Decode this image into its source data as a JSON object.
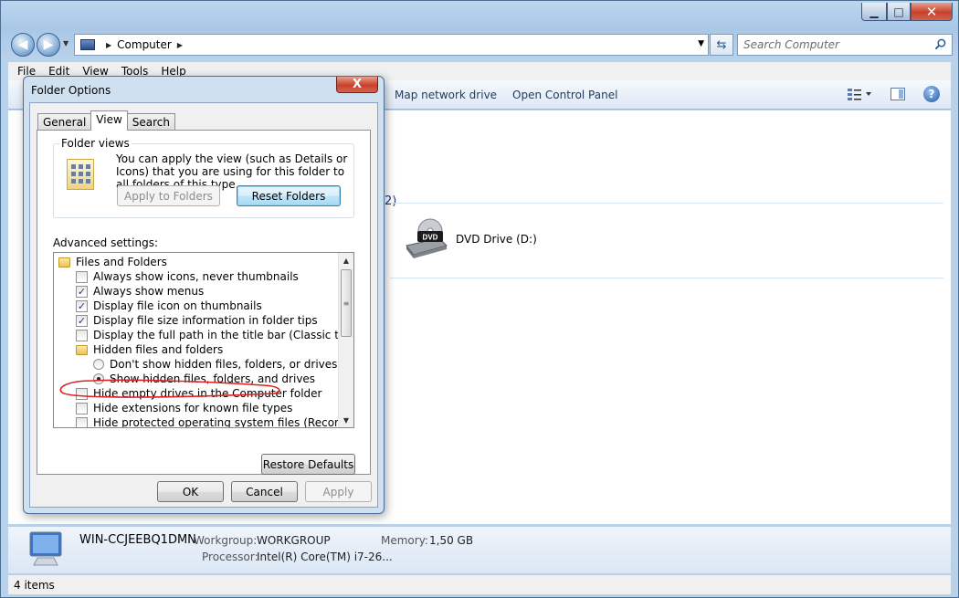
{
  "explorer": {
    "address": {
      "location": "Computer"
    },
    "search": {
      "placeholder": "Search Computer"
    },
    "menu": [
      "File",
      "Edit",
      "View",
      "Tools",
      "Help"
    ],
    "toolbar": {
      "map_network": "Map network drive",
      "control_panel": "Open Control Panel"
    },
    "partial_label": "2)",
    "drives": [
      {
        "name": "DVD Drive (D:)",
        "badge": "DVD"
      }
    ],
    "details": {
      "computer_name": "WIN-CCJEEBQ1DMN",
      "workgroup_label": "Workgroup:",
      "workgroup_value": "WORKGROUP",
      "memory_label": "Memory:",
      "memory_value": "1,50 GB",
      "processor_label": "Processor:",
      "processor_value": "Intel(R) Core(TM) i7-26..."
    },
    "status": "4 items"
  },
  "dialog": {
    "title": "Folder Options",
    "close": "X",
    "tabs": [
      "General",
      "View",
      "Search"
    ],
    "active_tab": "View",
    "folder_views": {
      "title": "Folder views",
      "text": "You can apply the view (such as Details or Icons) that you are using for this folder to all folders of this type.",
      "apply_button": "Apply to Folders",
      "reset_button": "Reset Folders"
    },
    "advanced_label": "Advanced settings:",
    "tree": [
      {
        "kind": "folder",
        "label": "Files and Folders",
        "indent": 0
      },
      {
        "kind": "checkbox",
        "label": "Always show icons, never thumbnails",
        "checked": false,
        "indent": 1
      },
      {
        "kind": "checkbox",
        "label": "Always show menus",
        "checked": true,
        "indent": 1
      },
      {
        "kind": "checkbox",
        "label": "Display file icon on thumbnails",
        "checked": true,
        "indent": 1
      },
      {
        "kind": "checkbox",
        "label": "Display file size information in folder tips",
        "checked": true,
        "indent": 1
      },
      {
        "kind": "checkbox",
        "label": "Display the full path in the title bar (Classic theme only)",
        "checked": false,
        "indent": 1
      },
      {
        "kind": "folder",
        "label": "Hidden files and folders",
        "indent": 1
      },
      {
        "kind": "radio",
        "label": "Don't show hidden files, folders, or drives",
        "checked": false,
        "indent": 2
      },
      {
        "kind": "radio",
        "label": "Show hidden files, folders, and drives",
        "checked": true,
        "indent": 2
      },
      {
        "kind": "checkbox",
        "label": "Hide empty drives in the Computer folder",
        "checked": false,
        "indent": 1
      },
      {
        "kind": "checkbox",
        "label": "Hide extensions for known file types",
        "checked": false,
        "indent": 1
      },
      {
        "kind": "checkbox",
        "label": "Hide protected operating system files (Recommended)",
        "checked": false,
        "indent": 1
      }
    ],
    "restore_defaults": "Restore Defaults",
    "ok": "OK",
    "cancel": "Cancel",
    "apply": "Apply"
  }
}
